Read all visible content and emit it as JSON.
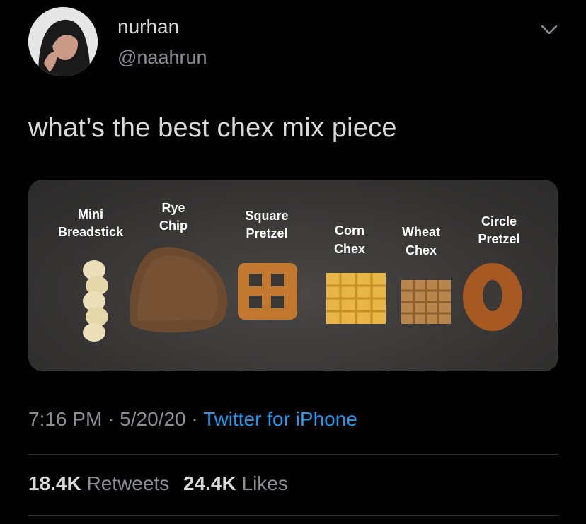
{
  "header": {
    "display_name": "nurhan",
    "handle": "@naahrun",
    "menu_icon": "chevron-down-icon"
  },
  "tweet": {
    "text": "what’s the best chex mix piece",
    "photo": {
      "labels": [
        {
          "line1": "Mini",
          "line2": "Breadstick"
        },
        {
          "line1": "Rye",
          "line2": "Chip"
        },
        {
          "line1": "Square",
          "line2": "Pretzel"
        },
        {
          "line1": "Corn",
          "line2": "Chex"
        },
        {
          "line1": "Wheat",
          "line2": "Chex"
        },
        {
          "line1": "Circle",
          "line2": "Pretzel"
        }
      ]
    },
    "time": "7:16 PM",
    "date": "5/20/20",
    "separator": "·",
    "source": "Twitter for iPhone"
  },
  "stats": {
    "retweets_count": "18.4K",
    "retweets_label": "Retweets",
    "likes_count": "24.4K",
    "likes_label": "Likes"
  },
  "colors": {
    "background": "#000000",
    "text": "#d9d9d9",
    "secondary": "#8a8f94",
    "link": "#1d9bf0",
    "divider": "#2f3336"
  }
}
